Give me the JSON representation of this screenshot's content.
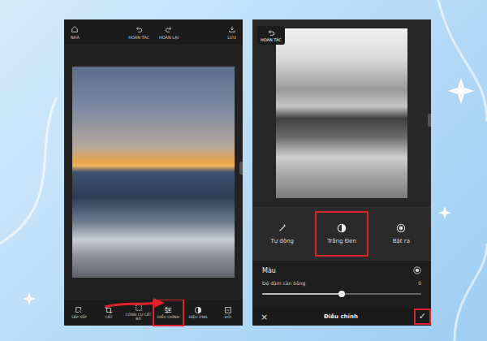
{
  "left_screen": {
    "top_bar": [
      {
        "label": "NHÀ",
        "kind": "home"
      },
      {
        "label": "HOÀN TÁC",
        "kind": "undo"
      },
      {
        "label": "HOÀN LẠI",
        "kind": "redo"
      },
      {
        "label": "LƯU",
        "kind": "save"
      }
    ],
    "toolbar": [
      {
        "label": "SẮP XẾP",
        "kind": "arrange",
        "selected": false
      },
      {
        "label": "CẮT",
        "kind": "crop",
        "selected": false
      },
      {
        "label": "CÔNG CỤ CẮT BỎ",
        "kind": "cutout",
        "selected": false
      },
      {
        "label": "ĐIỀU CHỈNH",
        "kind": "adjust",
        "selected": true
      },
      {
        "label": "HIỆU ỨNG",
        "kind": "effects",
        "selected": false
      },
      {
        "label": "ĐỔI",
        "kind": "swap",
        "selected": false
      }
    ]
  },
  "right_screen": {
    "undo_button": {
      "label": "HOÀN TÁC"
    },
    "modes": [
      {
        "label": "Tự động",
        "kind": "auto",
        "selected": false
      },
      {
        "label": "Trắng Đen",
        "kind": "bw",
        "selected": true
      },
      {
        "label": "Bật ra",
        "kind": "pop",
        "selected": false
      }
    ],
    "color_section": {
      "title": "Màu"
    },
    "slider": {
      "label": "Độ đậm cân bằng",
      "reading": "0",
      "level": 0.5
    },
    "bottom_bar": {
      "close": "×",
      "title": "Điều chỉnh",
      "confirm": {
        "label": "✓",
        "highlighted": true
      }
    }
  }
}
